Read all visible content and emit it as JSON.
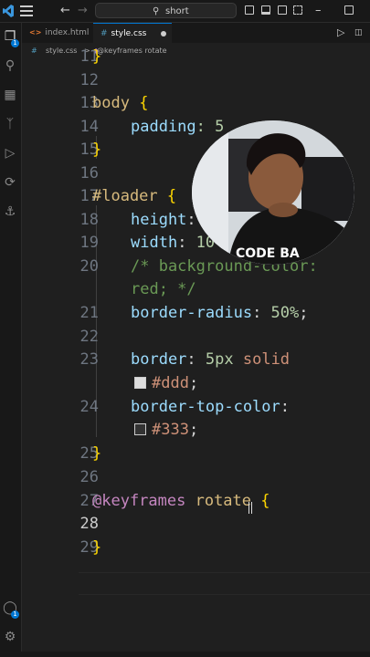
{
  "titlebar": {
    "search_text": "short"
  },
  "activity": {
    "badge_explorer": "1",
    "badge_settings": "1"
  },
  "tabs": [
    {
      "label": "index.html",
      "icon": "html-file-icon",
      "active": false
    },
    {
      "label": "style.css",
      "icon": "css-file-icon",
      "active": true,
      "modified": true
    }
  ],
  "breadcrumb": {
    "file": "style.css",
    "separator": ">",
    "symbol": "@keyframes rotate"
  },
  "editor": {
    "line_numbers": [
      "11",
      "12",
      "13",
      "14",
      "15",
      "16",
      "17",
      "18",
      "19",
      "20",
      "21",
      "22",
      "23",
      "24",
      "25",
      "26",
      "27",
      "28",
      "29"
    ],
    "current_line": "28",
    "lines": {
      "l11": "}",
      "l13_sel": "body",
      "l13_br": " {",
      "l14_prop": "padding",
      "l14_rest": ": 5",
      "l15": "}",
      "l17_sel": "#loader",
      "l17_br": " {",
      "l18_prop": "height",
      "l18_rest": ":",
      "l19_prop": "width",
      "l19_rest": ": ",
      "l19_num": "10",
      "l20a": "/* background-color:",
      "l20b": "red; */",
      "l21_prop": "border-radius",
      "l21_rest": ": ",
      "l21_num": "50%",
      "l21_end": ";",
      "l23_prop": "border",
      "l23_rest": ": ",
      "l23_num": "5px",
      "l23_val": " solid",
      "l23b_val": "#ddd",
      "l23b_end": ";",
      "l24_prop": "border-top-color",
      "l24_rest": ":",
      "l24b_val": "#333",
      "l24b_end": ";",
      "l25": "}",
      "l27_kw": "@keyframes",
      "l27_name": " rotate",
      "l27_br": " {",
      "l29": "}"
    },
    "swatch_colors": [
      "#dddddd",
      "#333333"
    ]
  },
  "webcam": {
    "shirt_text": "CODE BA"
  },
  "colors": {
    "accent": "#0078d4",
    "background": "#1f1f1f"
  }
}
